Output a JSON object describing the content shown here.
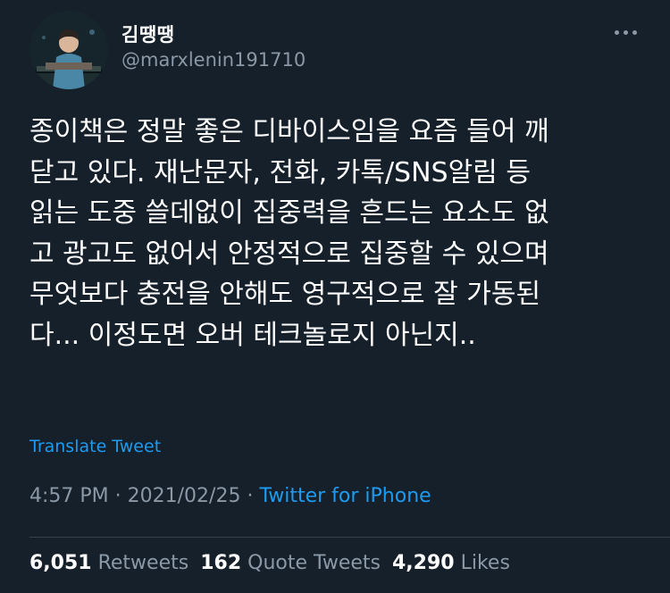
{
  "user": {
    "display_name": "김땡땡",
    "handle": "@marxlenin191710"
  },
  "more_icon": "more-horizontal-icon",
  "tweet": {
    "lines": [
      "종이책은 정말 좋은 디바이스임을 요즘 들어 깨",
      "닫고 있다. 재난문자, 전화, 카톡/SNS알림 등",
      "읽는 도중 쓸데없이 집중력을 흔드는 요소도 없",
      "고 광고도 없어서 안정적으로 집중할 수 있으며",
      "무엇보다 충전을 안해도 영구적으로 잘 가동된",
      "다... 이정도면 오버 테크놀로지 아닌지.."
    ],
    "translate_label": "Translate Tweet"
  },
  "meta": {
    "time": "4:57 PM",
    "separator": " · ",
    "date": "2021/02/25",
    "separator2": " · ",
    "source": "Twitter for iPhone"
  },
  "stats": {
    "retweets_count": "6,051",
    "retweets_label": "Retweets",
    "quotes_count": "162",
    "quotes_label": "Quote Tweets",
    "likes_count": "4,290",
    "likes_label": "Likes"
  },
  "colors": {
    "background": "#15202b",
    "text": "#ffffff",
    "secondary": "#8b98a5",
    "accent": "#1d9bf0",
    "divider": "#38444d"
  }
}
